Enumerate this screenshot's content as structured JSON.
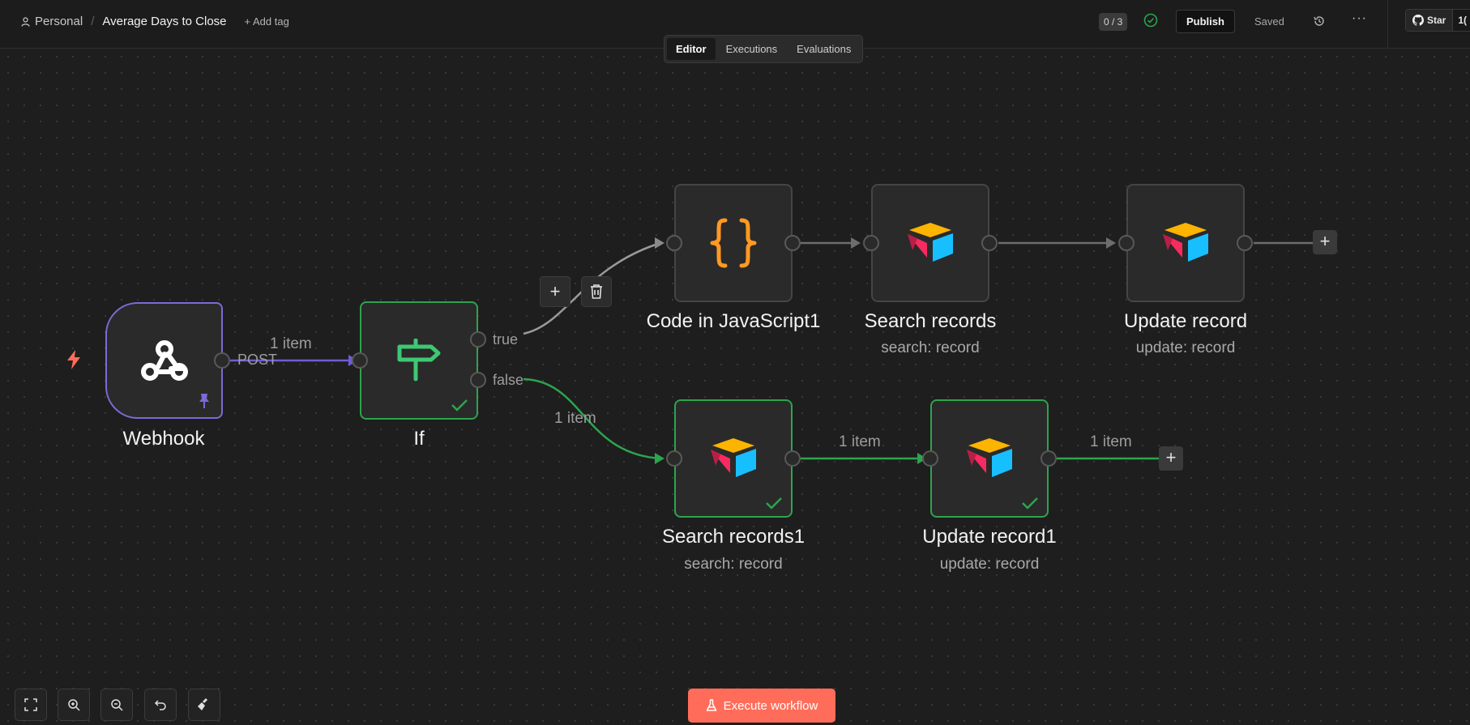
{
  "header": {
    "workspace": "Personal",
    "separator": "/",
    "workflow_title": "Average Days to Close",
    "add_tag": "+ Add tag",
    "counter": "0 / 3",
    "publish": "Publish",
    "status": "Saved",
    "more": "···",
    "github_star": "Star",
    "github_count": "1("
  },
  "tabs": [
    "Editor",
    "Executions",
    "Evaluations"
  ],
  "nodes": {
    "webhook": {
      "label": "Webhook"
    },
    "if": {
      "label": "If"
    },
    "code": {
      "label": "Code in JavaScript1"
    },
    "search": {
      "label": "Search records",
      "sub": "search: record"
    },
    "update": {
      "label": "Update record",
      "sub": "update: record"
    },
    "search1": {
      "label": "Search records1",
      "sub": "search: record"
    },
    "update1": {
      "label": "Update record1",
      "sub": "update: record"
    }
  },
  "edge_labels": {
    "webhook_if_count": "1 item",
    "webhook_method": "POST",
    "if_true": "true",
    "if_false": "false",
    "false_count": "1 item",
    "search1_update1_count": "1 item",
    "update1_out_count": "1 item"
  },
  "footer": {
    "execute": "Execute workflow"
  },
  "colors": {
    "accent": "#ff6d5a",
    "success": "#2da44e",
    "trigger": "#7b6bd6",
    "code": "#ff9922"
  }
}
